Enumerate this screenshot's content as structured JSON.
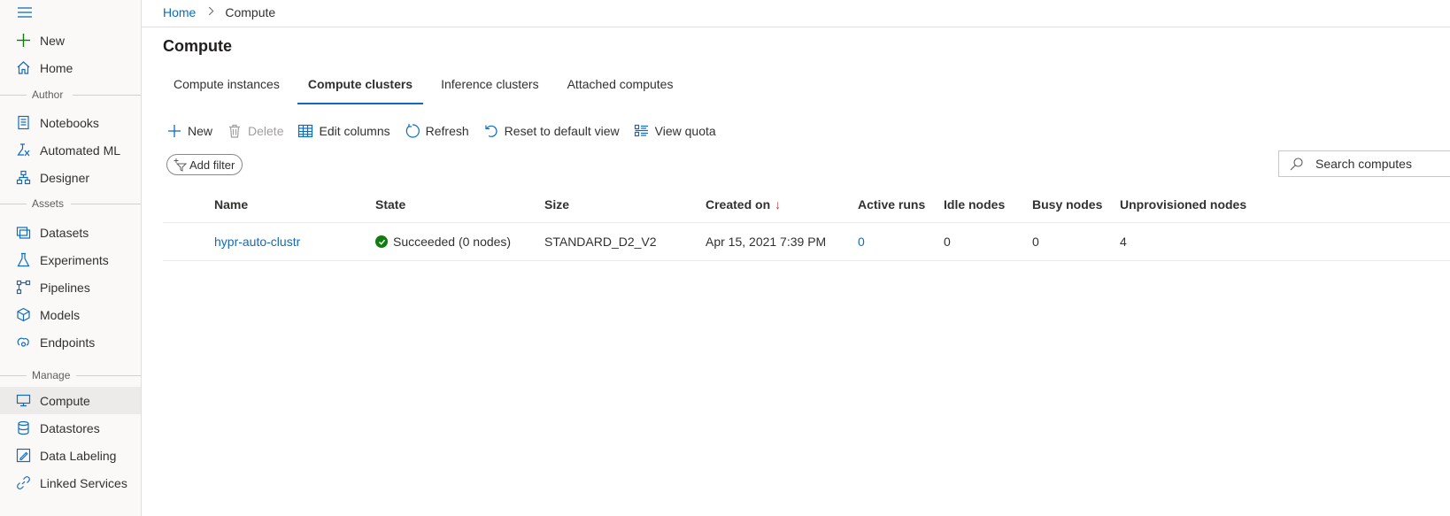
{
  "sidebar": {
    "top_items": [
      {
        "label": "New",
        "icon": "plus-icon"
      },
      {
        "label": "Home",
        "icon": "home-icon"
      }
    ],
    "sections": {
      "author": "Author",
      "assets": "Assets",
      "manage": "Manage"
    },
    "author_items": [
      {
        "label": "Notebooks",
        "icon": "notebook-icon"
      },
      {
        "label": "Automated ML",
        "icon": "automl-icon"
      },
      {
        "label": "Designer",
        "icon": "designer-icon"
      }
    ],
    "assets_items": [
      {
        "label": "Datasets",
        "icon": "datasets-icon"
      },
      {
        "label": "Experiments",
        "icon": "flask-icon"
      },
      {
        "label": "Pipelines",
        "icon": "pipelines-icon"
      },
      {
        "label": "Models",
        "icon": "cube-icon"
      },
      {
        "label": "Endpoints",
        "icon": "endpoints-icon"
      }
    ],
    "manage_items": [
      {
        "label": "Compute",
        "icon": "monitor-icon",
        "active": true
      },
      {
        "label": "Datastores",
        "icon": "database-icon"
      },
      {
        "label": "Data Labeling",
        "icon": "labeling-icon"
      },
      {
        "label": "Linked Services",
        "icon": "link-icon"
      }
    ]
  },
  "breadcrumb": {
    "home": "Home",
    "separator": ">",
    "current": "Compute"
  },
  "page_title": "Compute",
  "tabs": [
    {
      "label": "Compute instances",
      "active": false
    },
    {
      "label": "Compute clusters",
      "active": true
    },
    {
      "label": "Inference clusters",
      "active": false
    },
    {
      "label": "Attached computes",
      "active": false
    }
  ],
  "toolbar": {
    "new": "New",
    "delete": "Delete",
    "edit_columns": "Edit columns",
    "refresh": "Refresh",
    "reset_view": "Reset to default view",
    "view_quota": "View quota"
  },
  "filter": {
    "add_filter": "Add filter",
    "search_placeholder": "Search computes"
  },
  "table": {
    "columns": [
      "Name",
      "State",
      "Size",
      "Created on",
      "Active runs",
      "Idle nodes",
      "Busy nodes",
      "Unprovisioned nodes"
    ],
    "sort_indicator": "↓",
    "rows": [
      {
        "name": "hypr-auto-clustr",
        "state": "Succeeded (0 nodes)",
        "size": "STANDARD_D2_V2",
        "created_on": "Apr 15, 2021 7:39 PM",
        "active_runs": "0",
        "idle_nodes": "0",
        "busy_nodes": "0",
        "unprovisioned_nodes": "4"
      }
    ]
  },
  "colors": {
    "accent": "#0f6cbd",
    "success": "#107c10",
    "sort_arrow": "#d13438",
    "sidebar_bg": "#faf9f8",
    "active_bg": "#edebe9"
  }
}
